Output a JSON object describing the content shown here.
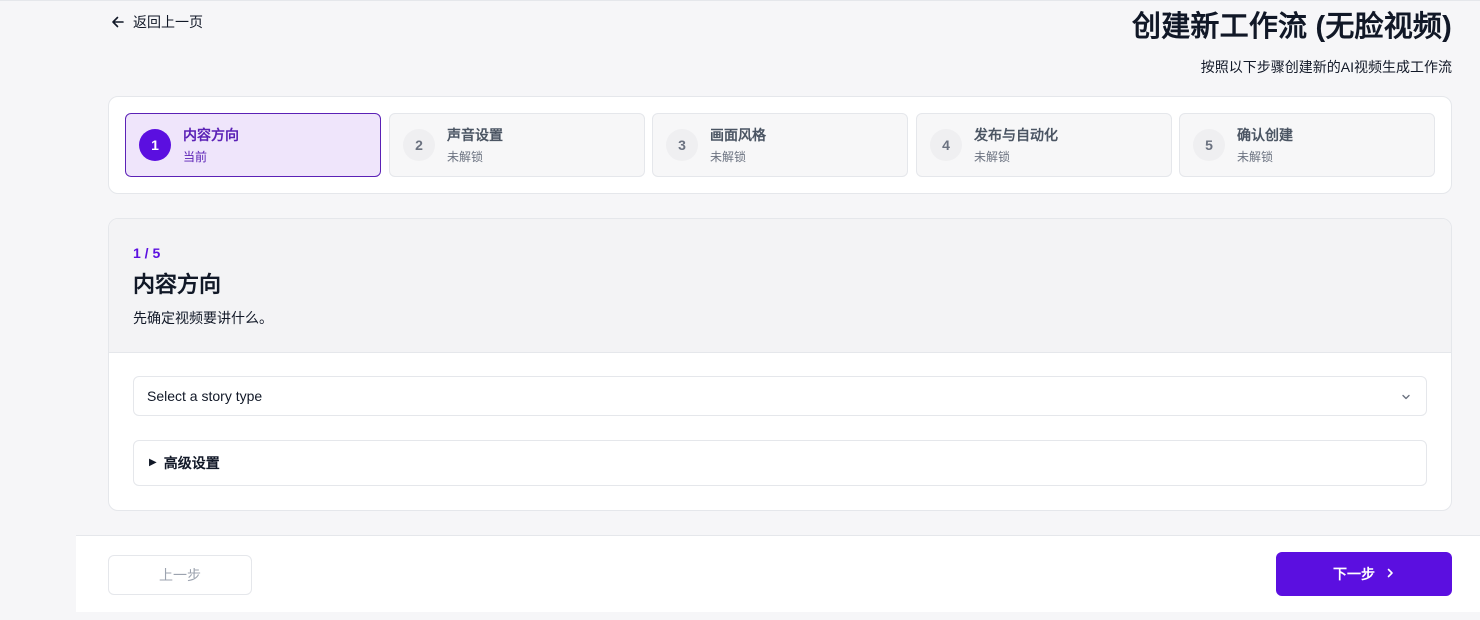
{
  "header": {
    "back_label": "返回上一页",
    "title": "创建新工作流 (无脸视频)",
    "subtitle": "按照以下步骤创建新的AI视频生成工作流"
  },
  "steps": [
    {
      "number": "1",
      "title": "内容方向",
      "status": "当前",
      "active": true
    },
    {
      "number": "2",
      "title": "声音设置",
      "status": "未解锁",
      "active": false
    },
    {
      "number": "3",
      "title": "画面风格",
      "status": "未解锁",
      "active": false
    },
    {
      "number": "4",
      "title": "发布与自动化",
      "status": "未解锁",
      "active": false
    },
    {
      "number": "5",
      "title": "确认创建",
      "status": "未解锁",
      "active": false
    }
  ],
  "section": {
    "progress": "1 / 5",
    "title": "内容方向",
    "description": "先确定视频要讲什么。"
  },
  "story_select": {
    "placeholder": "Select a story type",
    "icon": "chevron-down-icon"
  },
  "advanced": {
    "label": "高级设置",
    "icon": "triangle-right-icon"
  },
  "footer": {
    "prev_label": "上一步",
    "next_label": "下一步"
  },
  "colors": {
    "accent": "#5b0fe0",
    "active_step_bg": "#efe5fb",
    "active_step_border": "#5b21b6"
  }
}
